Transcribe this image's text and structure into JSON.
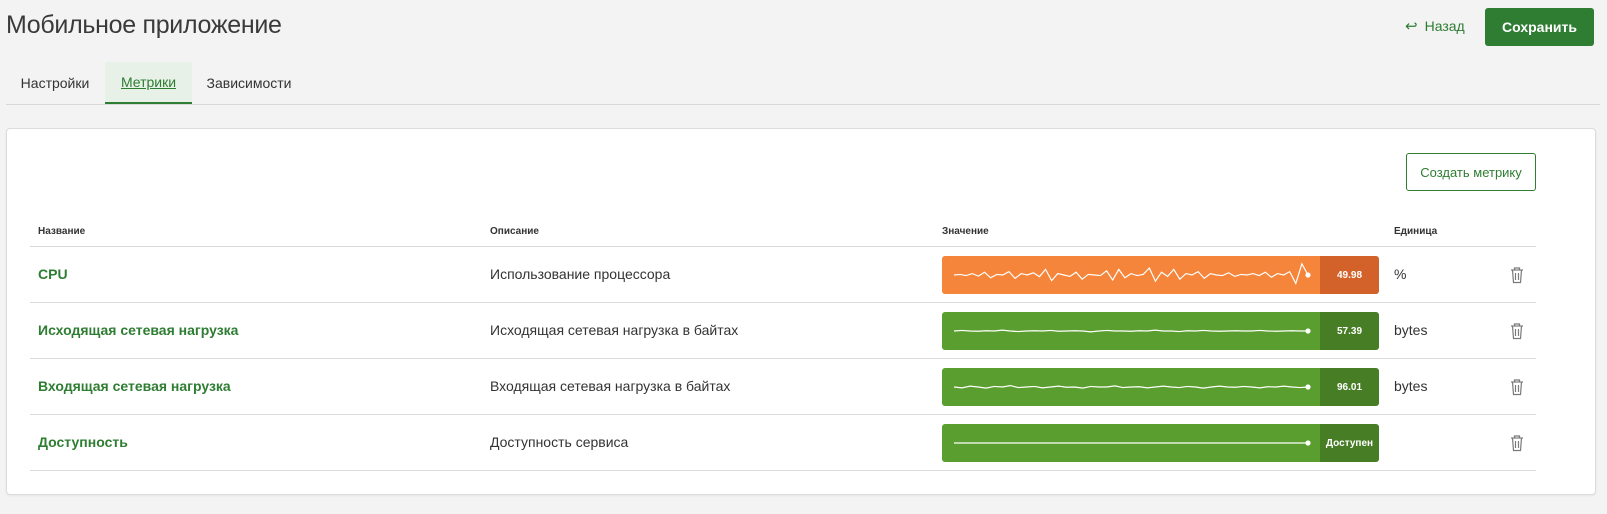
{
  "page": {
    "title": "Мобильное приложение",
    "back_label": "Назад",
    "back_icon": "return-arrow-icon",
    "save_label": "Сохранить"
  },
  "tabs": [
    {
      "label": "Настройки",
      "active": false
    },
    {
      "label": "Метрики",
      "active": true
    },
    {
      "label": "Зависимости",
      "active": false
    }
  ],
  "panel": {
    "create_label": "Создать метрику",
    "columns": {
      "name": "Название",
      "description": "Описание",
      "value": "Значение",
      "unit": "Единица"
    },
    "rows": [
      {
        "name": "CPU",
        "description": "Использование процессора",
        "value": "49.98",
        "unit": "%",
        "status": "warning",
        "bar_color": "#f5853a",
        "value_color": "#d2622a",
        "spark": [
          0.5,
          0.52,
          0.48,
          0.55,
          0.46,
          0.6,
          0.4,
          0.52,
          0.5,
          0.62,
          0.38,
          0.55,
          0.5,
          0.58,
          0.44,
          0.7,
          0.3,
          0.55,
          0.5,
          0.45,
          0.6,
          0.35,
          0.52,
          0.5,
          0.48,
          0.65,
          0.32,
          0.7,
          0.4,
          0.55,
          0.48,
          0.52,
          0.75,
          0.28,
          0.6,
          0.45,
          0.7,
          0.35,
          0.55,
          0.5,
          0.62,
          0.38,
          0.55,
          0.5,
          0.48,
          0.58,
          0.45,
          0.52,
          0.5,
          0.55,
          0.48,
          0.6,
          0.42,
          0.55,
          0.5,
          0.62,
          0.2,
          0.9,
          0.5
        ]
      },
      {
        "name": "Исходящая сетевая нагрузка",
        "description": "Исходящая сетевая нагрузка в байтах",
        "value": "57.39",
        "unit": "bytes",
        "status": "ok",
        "bar_color": "#5a9e2f",
        "value_color": "#467d25",
        "spark": [
          0.5,
          0.52,
          0.5,
          0.49,
          0.51,
          0.5,
          0.53,
          0.5,
          0.48,
          0.5,
          0.51,
          0.5,
          0.52,
          0.49,
          0.5,
          0.51,
          0.5,
          0.47,
          0.5,
          0.52,
          0.5,
          0.5,
          0.49,
          0.51,
          0.5,
          0.53,
          0.5,
          0.5,
          0.48,
          0.51,
          0.5,
          0.52,
          0.5,
          0.49,
          0.5,
          0.51,
          0.5,
          0.5,
          0.52,
          0.5,
          0.49,
          0.5,
          0.51,
          0.5,
          0.5
        ]
      },
      {
        "name": "Входящая сетевая нагрузка",
        "description": "Входящая сетевая нагрузка в байтах",
        "value": "96.01",
        "unit": "bytes",
        "status": "ok",
        "bar_color": "#5a9e2f",
        "value_color": "#467d25",
        "spark": [
          0.5,
          0.47,
          0.53,
          0.5,
          0.46,
          0.52,
          0.5,
          0.55,
          0.48,
          0.5,
          0.52,
          0.47,
          0.5,
          0.53,
          0.49,
          0.5,
          0.46,
          0.52,
          0.5,
          0.5,
          0.54,
          0.48,
          0.5,
          0.51,
          0.47,
          0.5,
          0.53,
          0.5,
          0.48,
          0.52,
          0.5,
          0.46,
          0.5,
          0.53,
          0.5,
          0.49,
          0.52,
          0.5,
          0.47,
          0.51,
          0.5,
          0.53,
          0.5,
          0.48,
          0.5
        ]
      },
      {
        "name": "Доступность",
        "description": "Доступность сервиса",
        "value": "Доступен",
        "unit": "",
        "status": "ok",
        "bar_color": "#5a9e2f",
        "value_color": "#467d25",
        "spark": [
          0.5,
          0.5,
          0.5,
          0.5,
          0.5,
          0.5,
          0.5,
          0.5,
          0.5,
          0.5
        ]
      }
    ],
    "delete_icon": "trash-icon"
  }
}
